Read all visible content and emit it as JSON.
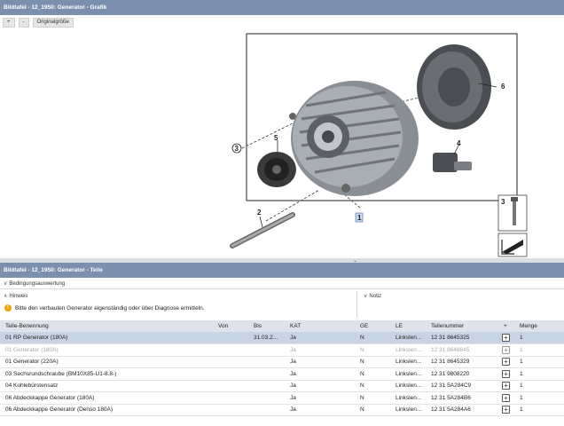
{
  "graphic": {
    "title": "Bildtafel - 12_1950: Generator - Grafik",
    "toolbar": {
      "zoom_in": "+",
      "zoom_out": "-",
      "original_size": "Originalgröße"
    },
    "callouts": [
      "1",
      "2",
      "3",
      "4",
      "5",
      "6"
    ]
  },
  "parts": {
    "title": "Bildtafel - 12_1950: Generator - Teile",
    "conditions_label": "Bedingungsauswertung",
    "hints_label": "Hinweis",
    "notes_label": "Notiz",
    "hint_text": "Bitte den verbauten Generator eigenständig oder über Diagnose ermitteln.",
    "columns": [
      "Teile-Benennung",
      "Von",
      "Bis",
      "KAT",
      "GE",
      "LE",
      "Teilenummer",
      "+",
      "Menge"
    ],
    "rows": [
      {
        "name": "01 RP Generator (180A)",
        "von": "",
        "bis": "31.03.2...",
        "kat": "Ja",
        "ge": "N",
        "le": "Linkslen...",
        "nr": "12 31 8645325",
        "menge": "1",
        "state": "selected"
      },
      {
        "name": "01 Generator (180A)",
        "von": "",
        "bis": "",
        "kat": "Ja",
        "ge": "N",
        "le": "Linkslen...",
        "nr": "12 31 8648845",
        "menge": "1",
        "state": "dim"
      },
      {
        "name": "01 Generator (220A)",
        "von": "",
        "bis": "",
        "kat": "Ja",
        "ge": "N",
        "le": "Linkslen...",
        "nr": "12 31 8645329",
        "menge": "1",
        "state": "normal"
      },
      {
        "name": "03 Sechsrundschraube (BM10X85-U1-8.8-)",
        "von": "",
        "bis": "",
        "kat": "Ja",
        "ge": "N",
        "le": "Linkslen...",
        "nr": "12 31 9808220",
        "menge": "1",
        "state": "normal"
      },
      {
        "name": "04 Kohlebürstensatz",
        "von": "",
        "bis": "",
        "kat": "Ja",
        "ge": "N",
        "le": "Linkslen...",
        "nr": "12 31 5A284C9",
        "menge": "1",
        "state": "normal"
      },
      {
        "name": "06 Abdeckkappe Generator (180A)",
        "von": "",
        "bis": "",
        "kat": "Ja",
        "ge": "N",
        "le": "Linkslen...",
        "nr": "12 31 5A284B6",
        "menge": "1",
        "state": "normal"
      },
      {
        "name": "06 Abdeckkappe Generator (Denso 180A)",
        "von": "",
        "bis": "",
        "kat": "Ja",
        "ge": "N",
        "le": "Linkslen...",
        "nr": "12 31 5A284A6",
        "menge": "1",
        "state": "normal"
      }
    ]
  }
}
